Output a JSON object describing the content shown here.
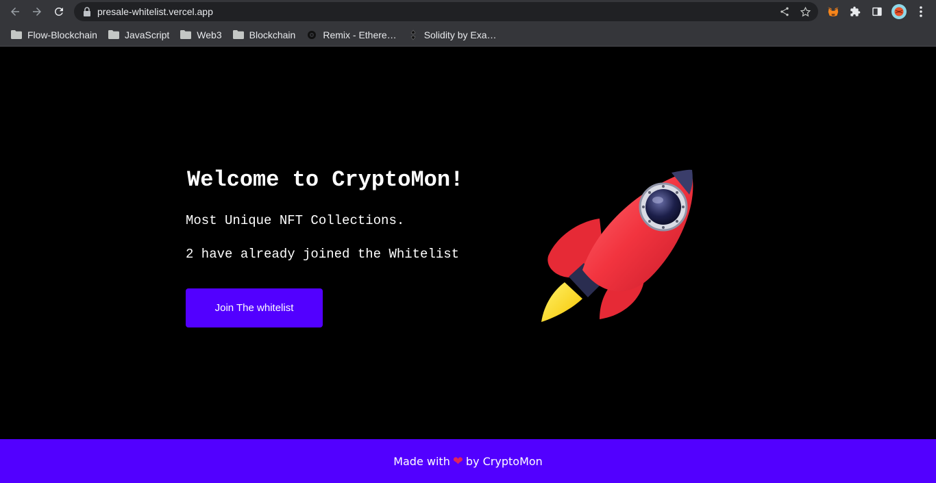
{
  "browser": {
    "url": "presale-whitelist.vercel.app",
    "bookmarks": [
      {
        "label": "Flow-Blockchain",
        "icon": "folder-icon"
      },
      {
        "label": "JavaScript",
        "icon": "folder-icon"
      },
      {
        "label": "Web3",
        "icon": "folder-icon"
      },
      {
        "label": "Blockchain",
        "icon": "folder-icon"
      },
      {
        "label": "Remix - Ethere…",
        "icon": "remix-icon"
      },
      {
        "label": "Solidity by Exa…",
        "icon": "solidity-icon"
      }
    ]
  },
  "hero": {
    "title": "Welcome to CryptoMon!",
    "description": "Most Unique NFT Collections.",
    "whitelist_count": "2 have already joined the Whitelist",
    "join_button": "Join The whitelist"
  },
  "footer": {
    "prefix": "Made with",
    "heart": "❤",
    "suffix": "by CryptoMon"
  },
  "colors": {
    "accent": "#5200ff",
    "background": "#000000",
    "rocket_body": "#f2343f"
  }
}
